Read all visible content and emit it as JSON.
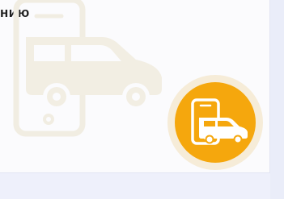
{
  "card": {
    "heading": "нию"
  },
  "icons": {
    "background": "phone-with-van-icon",
    "badge": "mobile-van-badge-icon"
  },
  "colors": {
    "page_bg": "#eef0fb",
    "card_bg": "#fbfbfd",
    "badge_fill": "#f5a70d",
    "badge_ring": "#f6ecd8",
    "illustration": "#f2eee3",
    "heading_text": "#1e1e1e"
  }
}
